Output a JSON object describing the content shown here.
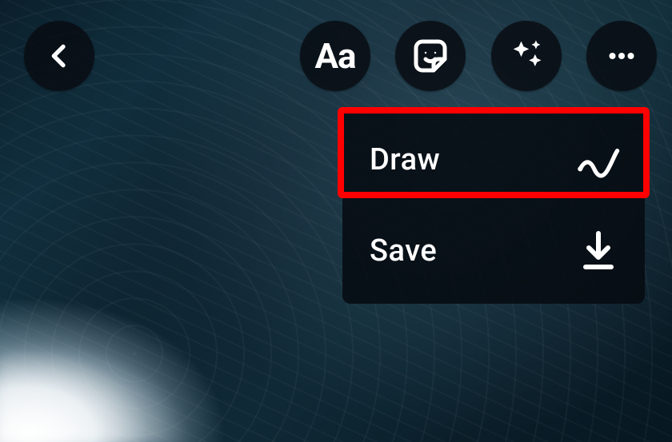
{
  "colors": {
    "highlight": "#ff0000",
    "buttonBg": "rgba(8,12,18,0.85)",
    "menuBg": "rgba(6,10,16,0.86)",
    "iconColor": "#ffffff"
  },
  "toolbar": {
    "text_tool_label": "Aa"
  },
  "menu": {
    "draw_label": "Draw",
    "save_label": "Save"
  }
}
